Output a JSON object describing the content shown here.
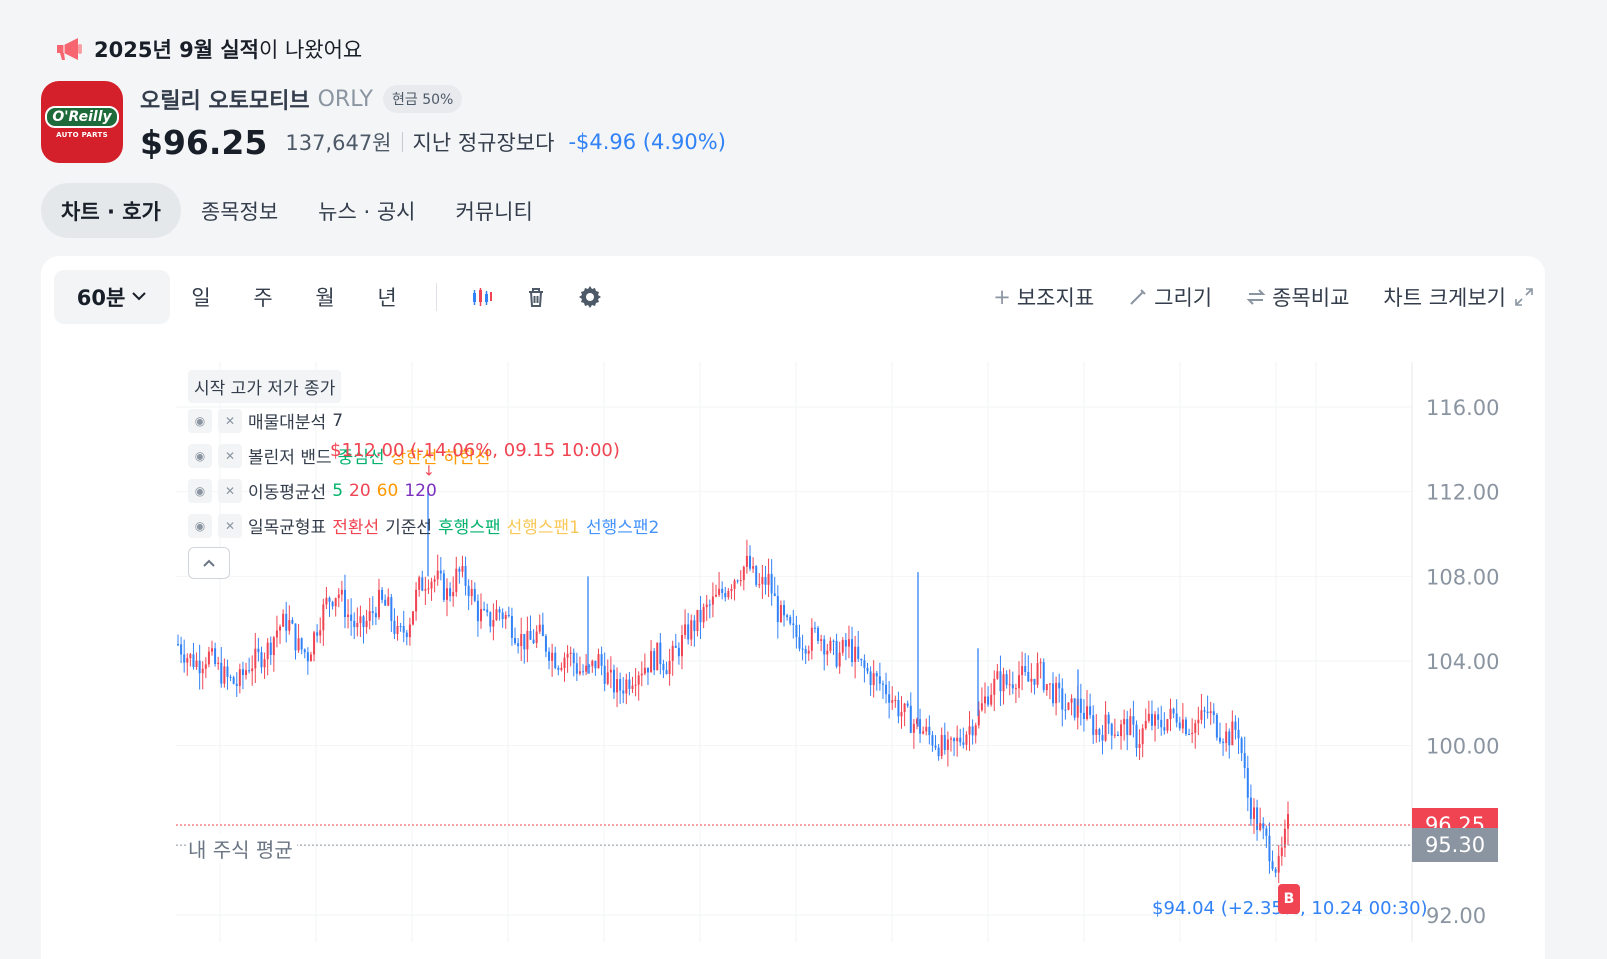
{
  "announcement": {
    "bold": "2025년 9월 실적",
    "rest": "이 나왔어요"
  },
  "stock": {
    "name": "오릴리 오토모티브",
    "ticker": "ORLY",
    "badge": "현금 50%",
    "logo_text_1": "O'Reilly",
    "logo_text_2": "AUTO PARTS",
    "price": "$96.25",
    "price_krw": "137,647원",
    "compare_label": "지난 정규장보다",
    "change": "-$4.96 (4.90%)"
  },
  "tabs": [
    {
      "label": "차트 · 호가",
      "active": true
    },
    {
      "label": "종목정보"
    },
    {
      "label": "뉴스 · 공시"
    },
    {
      "label": "커뮤니티"
    }
  ],
  "toolbar": {
    "interval": "60분",
    "periods": [
      "일",
      "주",
      "월",
      "년"
    ],
    "indicator_label": "보조지표",
    "draw_label": "그리기",
    "compare_label": "종목비교",
    "expand_label": "차트 크게보기"
  },
  "legend": {
    "header": "시작 고가 저가 종가",
    "rows": [
      {
        "name": "매물대분석",
        "items": [
          {
            "text": "7",
            "color": "#333d4b"
          }
        ]
      },
      {
        "name": "볼린저 밴드",
        "items": [
          {
            "text": "중심선",
            "color": "#03b26c"
          },
          {
            "text": "상한선",
            "color": "#fe9800"
          },
          {
            "text": "하한선",
            "color": "#fe9800"
          }
        ]
      },
      {
        "name": "이동평균선",
        "items": [
          {
            "text": "5",
            "color": "#03b26c"
          },
          {
            "text": "20",
            "color": "#f04452"
          },
          {
            "text": "60",
            "color": "#fe9800"
          },
          {
            "text": "120",
            "color": "#7b2fbe"
          }
        ]
      },
      {
        "name": "일목균형표",
        "items": [
          {
            "text": "전환선",
            "color": "#f04452"
          },
          {
            "text": "기준선",
            "color": "#333d4b"
          },
          {
            "text": "후행스팬",
            "color": "#03b26c"
          },
          {
            "text": "선행스팬1",
            "color": "#fac858"
          },
          {
            "text": "선행스팬2",
            "color": "#4593fc"
          }
        ]
      }
    ]
  },
  "chart_data": {
    "type": "candlestick",
    "y_ticks": [
      116,
      112,
      108,
      104,
      100,
      92
    ],
    "ylim": [
      91,
      118
    ],
    "current_price": 96.25,
    "avg_price": 95.3,
    "avg_label": "내 주식 평균",
    "high_note": "$112.00 (-14.06%, 09.15 10:00)",
    "low_note": "$94.04 (+2.35%, 10.24 00:30)",
    "buy_marker": "B",
    "up_color": "#f04452",
    "down_color": "#3182f6",
    "close_path": [
      104.8,
      104.2,
      103.9,
      104.3,
      103.6,
      103.1,
      102.9,
      103.8,
      104.1,
      104.6,
      105.6,
      105.9,
      104.7,
      104.3,
      105.8,
      106.9,
      107.3,
      106.2,
      105.4,
      105.9,
      106.8,
      106.5,
      105.1,
      105.7,
      107.4,
      108.0,
      107.8,
      107.1,
      108.2,
      107.6,
      106.3,
      105.8,
      106.4,
      106.0,
      105.2,
      104.8,
      105.3,
      104.6,
      104.0,
      104.4,
      103.6,
      103.4,
      104.1,
      103.2,
      102.6,
      103.1,
      103.6,
      103.9,
      104.3,
      103.8,
      104.6,
      105.4,
      105.9,
      106.5,
      107.0,
      107.6,
      108.2,
      108.6,
      107.4,
      107.9,
      106.3,
      105.5,
      105.1,
      104.9,
      105.4,
      104.6,
      104.2,
      104.8,
      103.9,
      103.4,
      103.0,
      102.6,
      101.8,
      101.3,
      100.9,
      100.5,
      100.1,
      99.7,
      100.2,
      100.8,
      101.4,
      102.5,
      103.1,
      102.9,
      103.4,
      103.0,
      103.6,
      102.8,
      102.3,
      101.6,
      101.9,
      101.3,
      100.6,
      101.1,
      100.7,
      101.0,
      100.2,
      101.2,
      100.9,
      101.3,
      101.5,
      100.9,
      101.1,
      101.6,
      100.8,
      100.4,
      100.9,
      97.5,
      96.2,
      95.3,
      94.04,
      96.25
    ],
    "high_spike": {
      "index": 25,
      "value": 112.0
    },
    "spikes": [
      {
        "index": 41,
        "value": 108.0
      },
      {
        "index": 74,
        "value": 108.2
      },
      {
        "index": 80,
        "value": 104.6
      },
      {
        "index": 90,
        "value": 103.6
      }
    ]
  }
}
